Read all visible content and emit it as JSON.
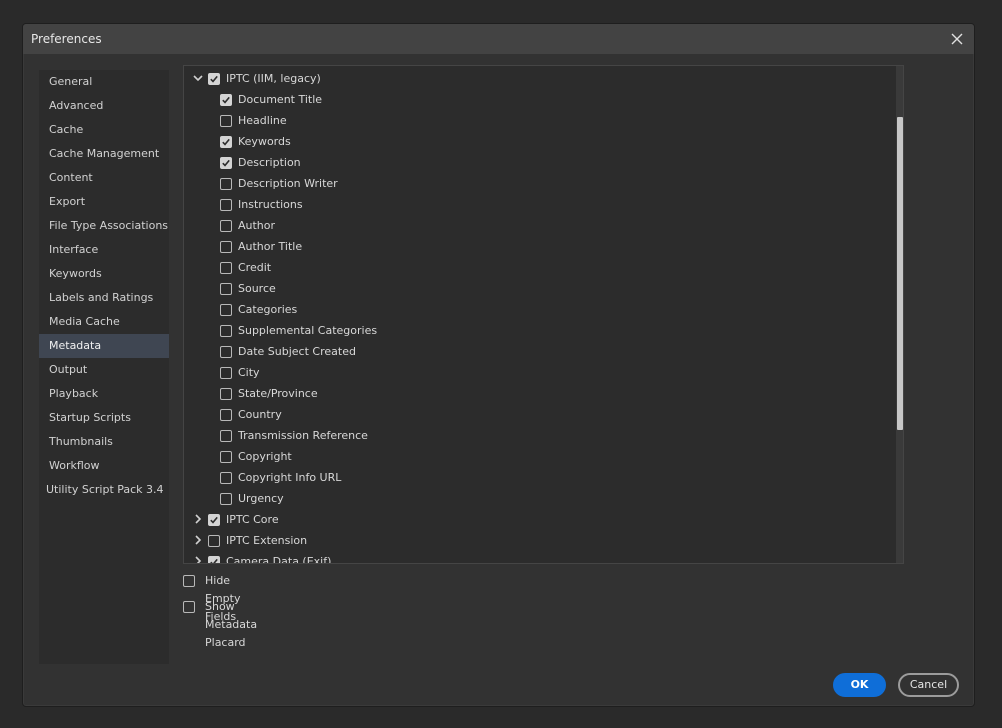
{
  "dialog": {
    "title": "Preferences",
    "close_icon": "close-icon"
  },
  "sidebar": {
    "items": [
      {
        "label": "General"
      },
      {
        "label": "Advanced"
      },
      {
        "label": "Cache"
      },
      {
        "label": "Cache Management"
      },
      {
        "label": "Content"
      },
      {
        "label": "Export"
      },
      {
        "label": "File Type Associations"
      },
      {
        "label": "Interface"
      },
      {
        "label": "Keywords"
      },
      {
        "label": "Labels and Ratings"
      },
      {
        "label": "Media Cache"
      },
      {
        "label": "Metadata",
        "selected": true
      },
      {
        "label": "Output"
      },
      {
        "label": "Playback"
      },
      {
        "label": "Startup Scripts"
      },
      {
        "label": "Thumbnails"
      },
      {
        "label": "Workflow"
      },
      {
        "label": "Utility Script Pack 3.4"
      }
    ]
  },
  "tree": {
    "groups": [
      {
        "label": "IPTC (IIM, legacy)",
        "expanded": true,
        "checked": true,
        "fields": [
          {
            "label": "Document Title",
            "checked": true
          },
          {
            "label": "Headline",
            "checked": false
          },
          {
            "label": "Keywords",
            "checked": true
          },
          {
            "label": "Description",
            "checked": true
          },
          {
            "label": "Description Writer",
            "checked": false
          },
          {
            "label": "Instructions",
            "checked": false
          },
          {
            "label": "Author",
            "checked": false
          },
          {
            "label": "Author Title",
            "checked": false
          },
          {
            "label": "Credit",
            "checked": false
          },
          {
            "label": "Source",
            "checked": false
          },
          {
            "label": "Categories",
            "checked": false
          },
          {
            "label": "Supplemental Categories",
            "checked": false
          },
          {
            "label": "Date Subject Created",
            "checked": false
          },
          {
            "label": "City",
            "checked": false
          },
          {
            "label": "State/Province",
            "checked": false
          },
          {
            "label": "Country",
            "checked": false
          },
          {
            "label": "Transmission Reference",
            "checked": false
          },
          {
            "label": "Copyright",
            "checked": false
          },
          {
            "label": "Copyright Info URL",
            "checked": false
          },
          {
            "label": "Urgency",
            "checked": false
          }
        ]
      },
      {
        "label": "IPTC Core",
        "expanded": false,
        "checked": true,
        "fields": []
      },
      {
        "label": "IPTC Extension",
        "expanded": false,
        "checked": false,
        "fields": []
      },
      {
        "label": "Camera Data (Exif)",
        "expanded": false,
        "checked": true,
        "fields": []
      }
    ]
  },
  "options": {
    "hide_empty_fields": {
      "label": "Hide Empty Fields",
      "checked": false
    },
    "show_metadata_placard": {
      "label": "Show Metadata Placard",
      "checked": false
    }
  },
  "buttons": {
    "ok_label": "OK",
    "cancel_label": "Cancel"
  }
}
